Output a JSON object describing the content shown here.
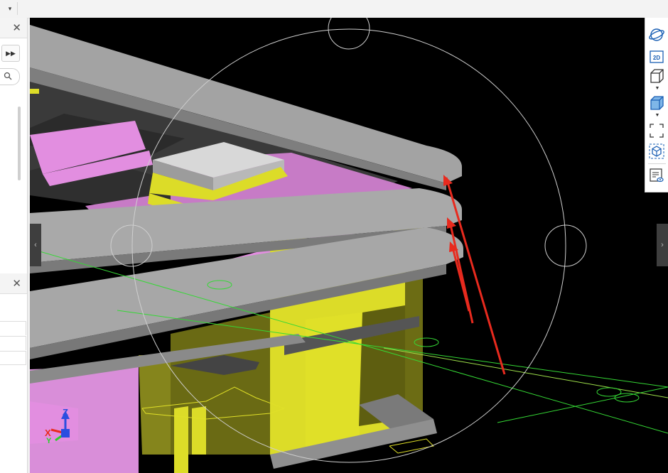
{
  "toolbar": {
    "dropdown_icon": "caret-down-icon"
  },
  "left_panel": {
    "panel1_close": "✕",
    "panel2_close": "✕",
    "expand_icon": "fast-forward-icon",
    "search_icon": "search-icon"
  },
  "viewport": {
    "background": "#000000",
    "left_tab_glyph": "‹",
    "right_tab_glyph": "›",
    "axis": {
      "z": "Z",
      "x": "X",
      "y": "Y"
    },
    "colors": {
      "structure": "#a3a3a3",
      "yellow_walls": "#dcdc28",
      "pink_walls": "#e28ee0",
      "grid_lines": "#35d835",
      "annotation_arrow": "#e82a1e"
    }
  },
  "view_tools": [
    {
      "name": "orbit-icon",
      "caret": false
    },
    {
      "name": "2d-view-icon",
      "label": "2D",
      "caret": false
    },
    {
      "name": "box-view-icon",
      "caret": true
    },
    {
      "name": "shaded-cube-icon",
      "caret": true
    },
    {
      "name": "fit-view-icon",
      "caret": false
    },
    {
      "name": "isolate-cube-icon",
      "caret": false
    },
    {
      "name": "properties-view-icon",
      "caret": false
    }
  ]
}
